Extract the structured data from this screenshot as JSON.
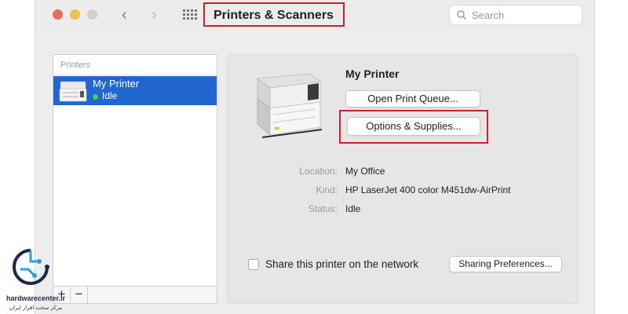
{
  "window": {
    "title": "Printers & Scanners",
    "search_placeholder": "Search",
    "nav_back": "‹",
    "nav_forward": "›"
  },
  "printer_list": {
    "header": "Printers",
    "items": [
      {
        "name": "My Printer",
        "status": "Idle",
        "status_color": "#3fd34a"
      }
    ],
    "add_button": "+",
    "remove_button": "−"
  },
  "detail": {
    "printer_name": "My Printer",
    "open_queue_label": "Open Print Queue...",
    "options_supplies_label": "Options & Supplies...",
    "info": [
      {
        "key": "Location:",
        "value": "My Office"
      },
      {
        "key": "Kind:",
        "value": "HP LaserJet 400 color M451dw-AirPrint"
      },
      {
        "key": "Status:",
        "value": "Idle"
      }
    ],
    "share_label": "Share this printer on the network",
    "share_checked": false,
    "sharing_prefs_label": "Sharing Preferences..."
  },
  "watermark": {
    "site": "hardwarecenter.ir",
    "tagline": "مرکز سخت افزار ایران"
  },
  "colors": {
    "selection": "#2266cf",
    "highlight_box": "#c8232c"
  }
}
